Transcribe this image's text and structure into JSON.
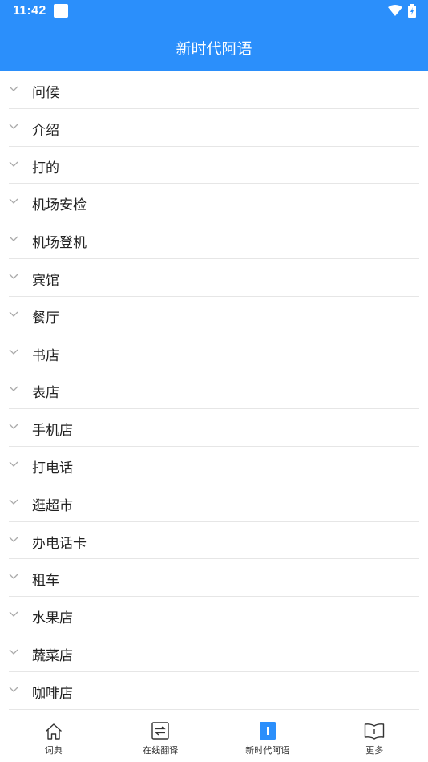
{
  "status": {
    "time": "11:42"
  },
  "header": {
    "title": "新时代阿语"
  },
  "list": [
    {
      "label": "问候"
    },
    {
      "label": "介绍"
    },
    {
      "label": "打的"
    },
    {
      "label": "机场安检"
    },
    {
      "label": "机场登机"
    },
    {
      "label": "宾馆"
    },
    {
      "label": "餐厅"
    },
    {
      "label": "书店"
    },
    {
      "label": "表店"
    },
    {
      "label": "手机店"
    },
    {
      "label": "打电话"
    },
    {
      "label": "逛超市"
    },
    {
      "label": "办电话卡"
    },
    {
      "label": "租车"
    },
    {
      "label": "水果店"
    },
    {
      "label": "蔬菜店"
    },
    {
      "label": "咖啡店"
    }
  ],
  "tabs": [
    {
      "label": "词典",
      "icon": "home-icon"
    },
    {
      "label": "在线翻译",
      "icon": "translate-icon"
    },
    {
      "label": "新时代阿语",
      "icon": "book-mark-icon",
      "active": true
    },
    {
      "label": "更多",
      "icon": "open-book-icon"
    }
  ],
  "colors": {
    "accent": "#2b8ffb",
    "divider": "#e6e6e6"
  }
}
